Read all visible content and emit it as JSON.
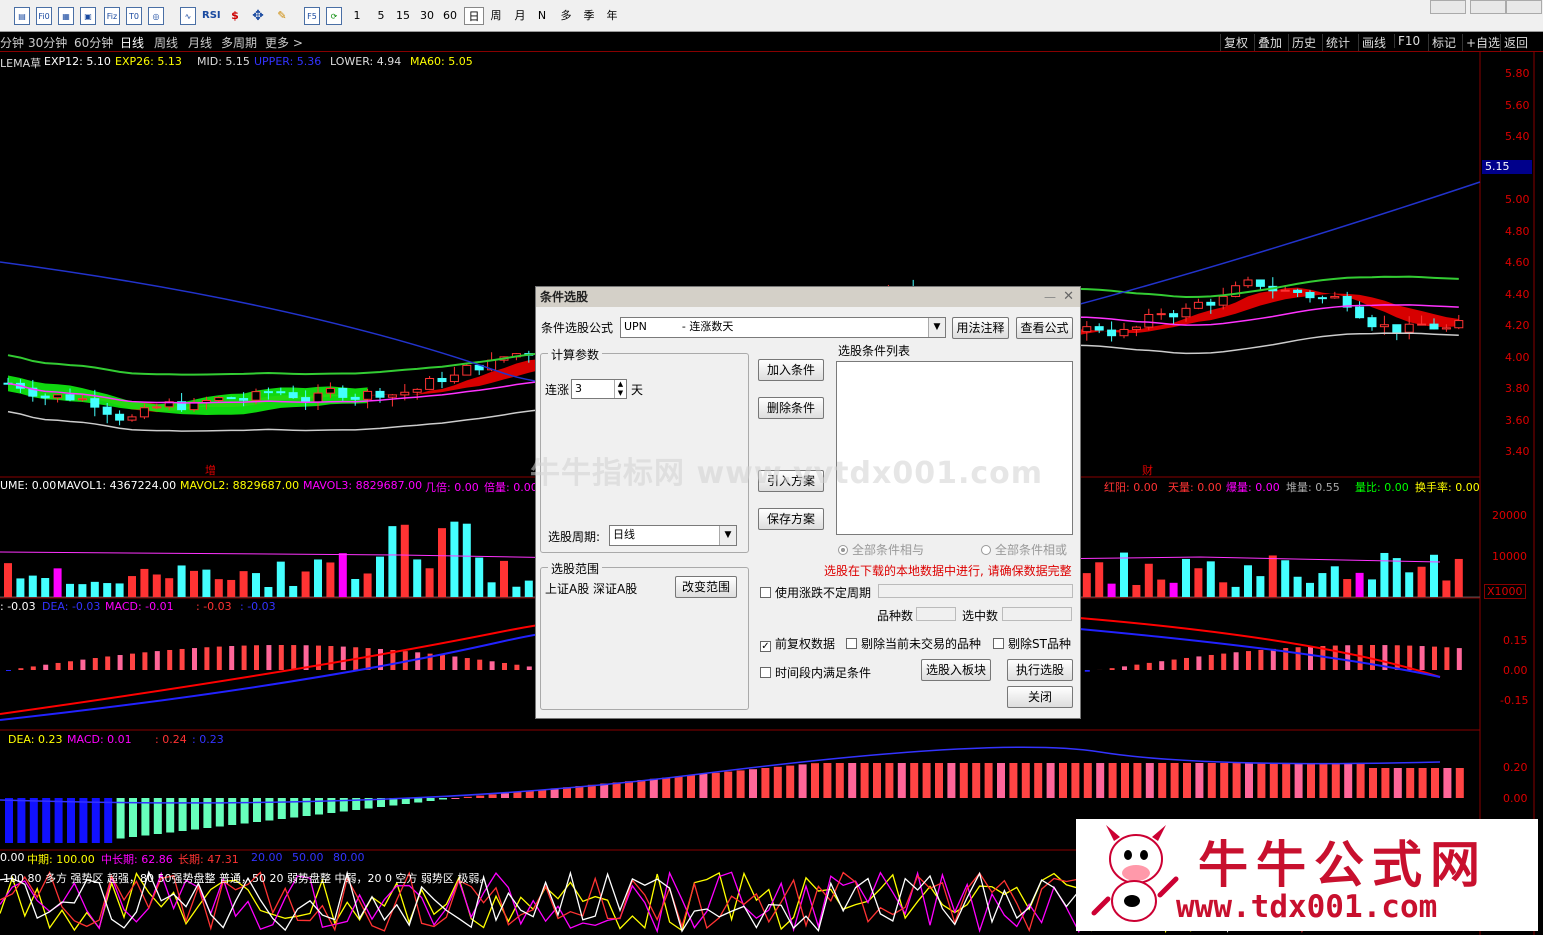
{
  "toolbar": {
    "nums": [
      "1",
      "5",
      "15",
      "30",
      "60"
    ],
    "periods": [
      "日",
      "周",
      "月",
      "N",
      "多",
      "季",
      "年"
    ],
    "icons": [
      "chart-icon",
      "f10-icon",
      "file-icon",
      "doc-icon",
      "fiz-icon",
      "t0-icon",
      "indicator-icon",
      "rsi-icon",
      "dollar-icon",
      "move-icon",
      "pen-icon",
      "f5-icon",
      "refresh-icon"
    ]
  },
  "period_bar": {
    "left": [
      "分钟",
      "30分钟",
      "60分钟",
      "日线",
      "周线",
      "月线",
      "多周期",
      "更多 >"
    ],
    "right": [
      "复权",
      "叠加",
      "历史",
      "统计",
      "画线",
      "F10",
      "标记",
      "+自选",
      "返回"
    ]
  },
  "main_legend": {
    "name": "LEMA草",
    "exp12": "EXP12: 5.10",
    "exp26": "EXP26: 5.13",
    "mid": "MID: 5.15",
    "upper": "UPPER: 5.36",
    "lower": "LOWER: 4.94",
    "ma60": "MA60: 5.05"
  },
  "price_axis": [
    "5.80",
    "5.60",
    "5.40",
    "5.20",
    "5.00",
    "4.80",
    "4.60",
    "4.40",
    "4.20",
    "4.00",
    "3.80",
    "3.60",
    "3.40"
  ],
  "current_price": "5.15",
  "markers": {
    "zeng": "增",
    "cai": "财"
  },
  "vol_legend": {
    "a": "UME: 0.00",
    "b": "MAVOL1: 4367224.00",
    "c": "MAVOL2: 8829687.00",
    "d": "MAVOL3: 8829687.00",
    "e": "几倍: 0.00",
    "f": "倍量: 0.00",
    "g": "红阳: 0.00",
    "h": "天量: 0.00",
    "i": "爆量: 0.00",
    "j": "堆量: 0.55",
    "k": "量比: 0.00",
    "l": "换手率: 0.00"
  },
  "vol_axis": [
    "20000",
    "10000"
  ],
  "vol_unit": "X1000",
  "macd_legend": {
    "a": ": -0.03",
    "b": "DEA: -0.03",
    "c": "MACD: -0.01",
    "d": ": -0.03",
    "e": ": -0.03"
  },
  "macd_axis": [
    "0.15",
    "0.00",
    "-0.15"
  ],
  "macd2_legend": {
    "a": "DEA: 0.23",
    "b": "MACD: 0.01",
    "c": ": 0.24",
    "d": ": 0.23"
  },
  "macd2_axis": [
    "0.20",
    "0.00"
  ],
  "strength_legend": {
    "a": "0.00",
    "b": "中期: 100.00",
    "c": "中长期: 62.86",
    "d": "长期: 47.31",
    "e": "20.00",
    "f": "50.00",
    "g": "80.00"
  },
  "strength_note": "100 80 多方 强势区 超强，80 50强势盘整 普通，50 20 弱势盘整 中弱，20 0 空方 弱势区 极弱。",
  "dialog": {
    "title": "条件选股",
    "formula_label": "条件选股公式",
    "formula_value": "UPN          - 连涨数天",
    "btn_usage": "用法注释",
    "btn_view": "查看公式",
    "params_group": "计算参数",
    "param_label": "连涨",
    "param_value": "3",
    "param_unit": "天",
    "period_label": "选股周期:",
    "period_value": "日线",
    "list_label": "选股条件列表",
    "btn_add": "加入条件",
    "btn_del": "删除条件",
    "btn_import": "引入方案",
    "btn_save": "保存方案",
    "radio_and": "全部条件相与",
    "radio_or": "全部条件相或",
    "warning": "选股在下载的本地数据中进行, 请确保数据完整",
    "scope_group": "选股范围",
    "scope_value": "上证A股 深证A股",
    "btn_scope": "改变范围",
    "chk_unfixed": "使用涨跌不定周期",
    "count_label": "品种数",
    "selected_label": "选中数",
    "chk_fq": "前复权数据",
    "chk_notrade": "剔除当前未交易的品种",
    "chk_st": "剔除ST品种",
    "chk_period": "时间段内满足条件",
    "btn_toblock": "选股入板块",
    "btn_exec": "执行选股",
    "btn_close": "关闭"
  },
  "watermark": "牛牛指标网 www.vvtdx001.com",
  "logo": {
    "title": "牛牛公式网",
    "url": "www.tdx001.com"
  }
}
